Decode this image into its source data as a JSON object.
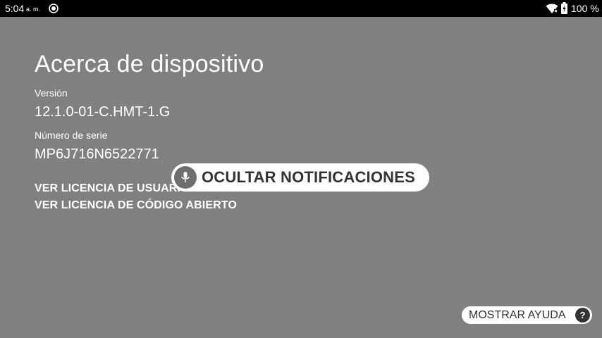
{
  "status_bar": {
    "time": "5:04",
    "ampm": "a. m.",
    "battery_percent": "100 %",
    "icons": [
      "status-dot-icon",
      "wifi-icon",
      "battery-icon"
    ]
  },
  "page": {
    "title": "Acerca de dispositivo",
    "version_label": "Versión",
    "version_value": "12.1.0-01-C.HMT-1.G",
    "serial_label": "Número de serie",
    "serial_value": "MP6J716N6522771",
    "links": {
      "user_license": "VER LICENCIA DE USUARIO",
      "open_source_license": "VER LICENCIA DE CÓDIGO ABIERTO"
    }
  },
  "voice_overlay": {
    "label": "OCULTAR NOTIFICACIONES",
    "icon": "microphone-icon"
  },
  "help": {
    "label": "MOSTRAR AYUDA",
    "icon_glyph": "?"
  },
  "colors": {
    "background": "#808080",
    "status_bar": "#000000",
    "pill_background": "#ffffff",
    "pill_text": "#333333"
  }
}
